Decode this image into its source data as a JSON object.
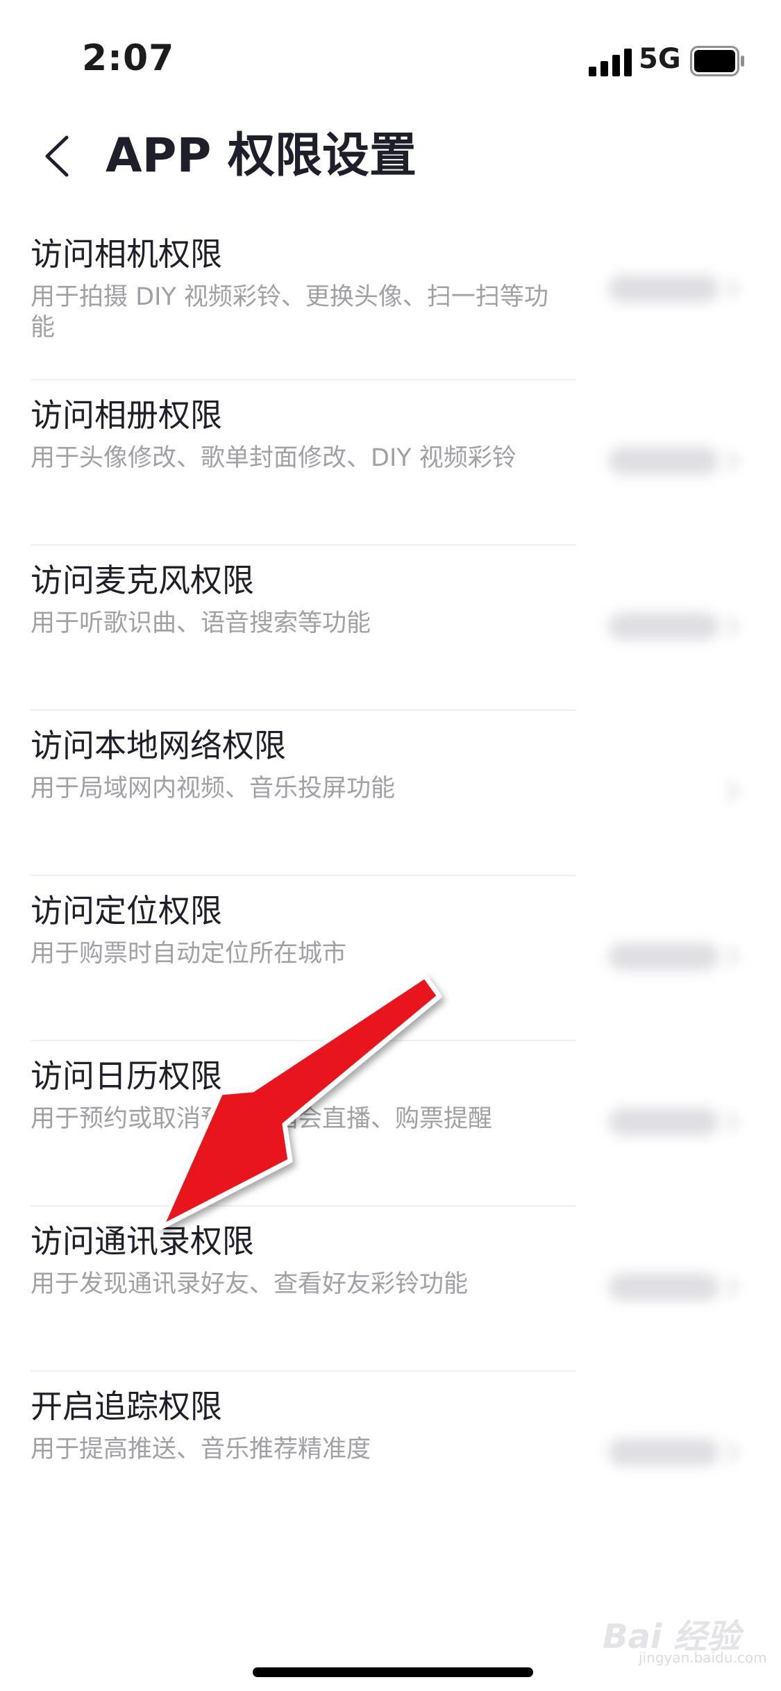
{
  "status_bar": {
    "time": "2:07",
    "network": "5G",
    "icons": [
      "signal-icon",
      "battery-icon"
    ]
  },
  "header": {
    "back_icon": "chevron-left-icon",
    "title": "APP 权限设置"
  },
  "permissions": [
    {
      "title": "访问相机权限",
      "description": "用于拍摄 DIY 视频彩铃、更换头像、扫一扫等功能"
    },
    {
      "title": "访问相册权限",
      "description": "用于头像修改、歌单封面修改、DIY 视频彩铃"
    },
    {
      "title": "访问麦克风权限",
      "description": "用于听歌识曲、语音搜索等功能"
    },
    {
      "title": "访问本地网络权限",
      "description": "用于局域网内视频、音乐投屏功能"
    },
    {
      "title": "访问定位权限",
      "description": "用于购票时自动定位所在城市"
    },
    {
      "title": "访问日历权限",
      "description": "用于预约或取消预约演唱会直播、购票提醒"
    },
    {
      "title": "访问通讯录权限",
      "description": "用于发现通讯录好友、查看好友彩铃功能"
    },
    {
      "title": "开启追踪权限",
      "description": "用于提高推送、音乐推荐精准度"
    }
  ],
  "annotation": {
    "type": "arrow",
    "color": "#e8141c",
    "points_to": "访问通讯录权限"
  },
  "watermark": {
    "brand": "Bai 经验",
    "url": "jingyan.baidu.com"
  },
  "colors": {
    "title_text": "#1f1f2b",
    "description_text": "#a0a0a6",
    "divider": "#efeff2"
  }
}
